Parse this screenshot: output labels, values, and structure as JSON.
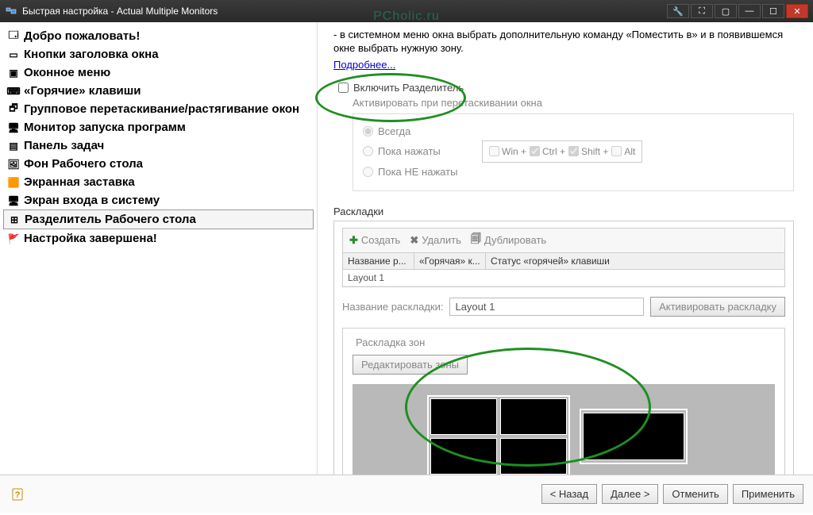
{
  "watermark": "PCholic.ru",
  "titlebar": {
    "title": "Быстрая настройка - Actual Multiple Monitors"
  },
  "sidebar": {
    "items": [
      {
        "icon": "🗔",
        "label": "Добро пожаловать!"
      },
      {
        "icon": "▭",
        "label": "Кнопки заголовка окна"
      },
      {
        "icon": "▣",
        "label": "Оконное меню"
      },
      {
        "icon": "⌨",
        "label": "«Горячие» клавиши"
      },
      {
        "icon": "🗗",
        "label": "Групповое перетаскивание/растягивание окон"
      },
      {
        "icon": "🖥",
        "label": "Монитор запуска программ"
      },
      {
        "icon": "▤",
        "label": "Панель задач"
      },
      {
        "icon": "🖼",
        "label": "Фон Рабочего стола"
      },
      {
        "icon": "🟧",
        "label": "Экранная заставка"
      },
      {
        "icon": "🖥",
        "label": "Экран входа в систему"
      },
      {
        "icon": "⊞",
        "label": "Разделитель Рабочего стола"
      },
      {
        "icon": "🚩",
        "label": "Настройка завершена!"
      }
    ],
    "selected_index": 10
  },
  "content": {
    "intro": "- в системном меню окна выбрать дополнительную команду «Поместить в» и в появившемся окне выбрать нужную зону.",
    "more_link": "Подробнее...",
    "enable_divider_label": "Включить Разделитель",
    "activate_group": {
      "title": "Активировать при перетаскивании окна",
      "radios": {
        "always": "Всегда",
        "while_pressed": "Пока нажаты",
        "while_not_pressed": "Пока НЕ нажаты"
      },
      "modifiers": {
        "win": "Win +",
        "ctrl": "Ctrl +",
        "shift": "Shift +",
        "alt": "Alt"
      }
    },
    "layouts": {
      "title": "Раскладки",
      "toolbar": {
        "create": "Создать",
        "delete": "Удалить",
        "duplicate": "Дублировать"
      },
      "columns": [
        "Название р...",
        "«Горячая» к...",
        "Статус «горячей» клавиши"
      ],
      "rows": [
        {
          "name": "Layout 1",
          "hotkey": "",
          "status": ""
        }
      ],
      "name_label": "Название раскладки:",
      "name_value": "Layout 1",
      "activate_btn": "Активировать раскладку"
    },
    "zones": {
      "title": "Раскладка зон",
      "edit_btn": "Редактировать зоны"
    }
  },
  "bottom": {
    "back": "< Назад",
    "next": "Далее >",
    "cancel": "Отменить",
    "apply": "Применить"
  }
}
